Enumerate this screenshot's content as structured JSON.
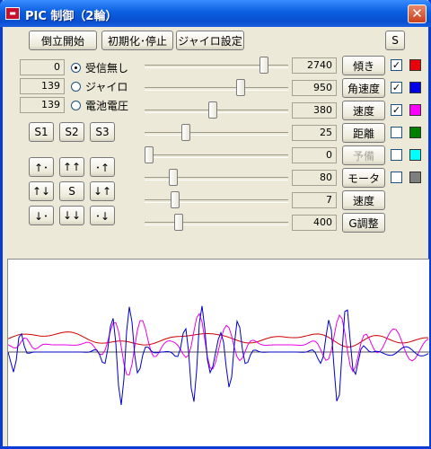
{
  "window": {
    "title": "PIC 制御（2輪）",
    "close_glyph": "✕"
  },
  "toolbar": {
    "start_label": "倒立開始",
    "init_label": "初期化･停止",
    "gyro_label": "ジャイロ設定",
    "s_label": "S"
  },
  "radios": [
    {
      "value": "0",
      "label": "受信無し",
      "checked": true
    },
    {
      "value": "139",
      "label": "ジャイロ",
      "checked": false
    },
    {
      "value": "139",
      "label": "電池電圧",
      "checked": false
    }
  ],
  "preset_buttons": [
    "S1",
    "S2",
    "S3"
  ],
  "motion_buttons": [
    [
      "↑･",
      "↑↑",
      "･↑"
    ],
    [
      "↑↓",
      "S",
      "↓↑"
    ],
    [
      "↓･",
      "↓↓",
      "･↓"
    ]
  ],
  "params": [
    {
      "level": 0.85,
      "value": "2740",
      "label": "傾き",
      "disabled": false,
      "checked": true,
      "color": "#e8000b"
    },
    {
      "level": 0.68,
      "value": "950",
      "label": "角速度",
      "disabled": false,
      "checked": true,
      "color": "#0000e8"
    },
    {
      "level": 0.47,
      "value": "380",
      "label": "速度",
      "disabled": false,
      "checked": true,
      "color": "#ff00ff"
    },
    {
      "level": 0.27,
      "value": "25",
      "label": "距離",
      "disabled": false,
      "checked": false,
      "color": "#008000"
    },
    {
      "level": 0.0,
      "value": "0",
      "label": "予備",
      "disabled": true,
      "checked": false,
      "color": "#00ffff"
    },
    {
      "level": 0.18,
      "value": "80",
      "label": "モータ",
      "disabled": false,
      "checked": false,
      "color": "#7f7f7f"
    },
    {
      "level": 0.19,
      "value": "7",
      "label": "速度",
      "disabled": false
    },
    {
      "level": 0.22,
      "value": "400",
      "label": "G調整",
      "disabled": false
    }
  ],
  "check_glyph": "✓",
  "plot": {
    "colors": {
      "red": "#cc0000",
      "blue": "#0000cc",
      "magenta": "#e800e8",
      "axis": "#555555"
    }
  }
}
